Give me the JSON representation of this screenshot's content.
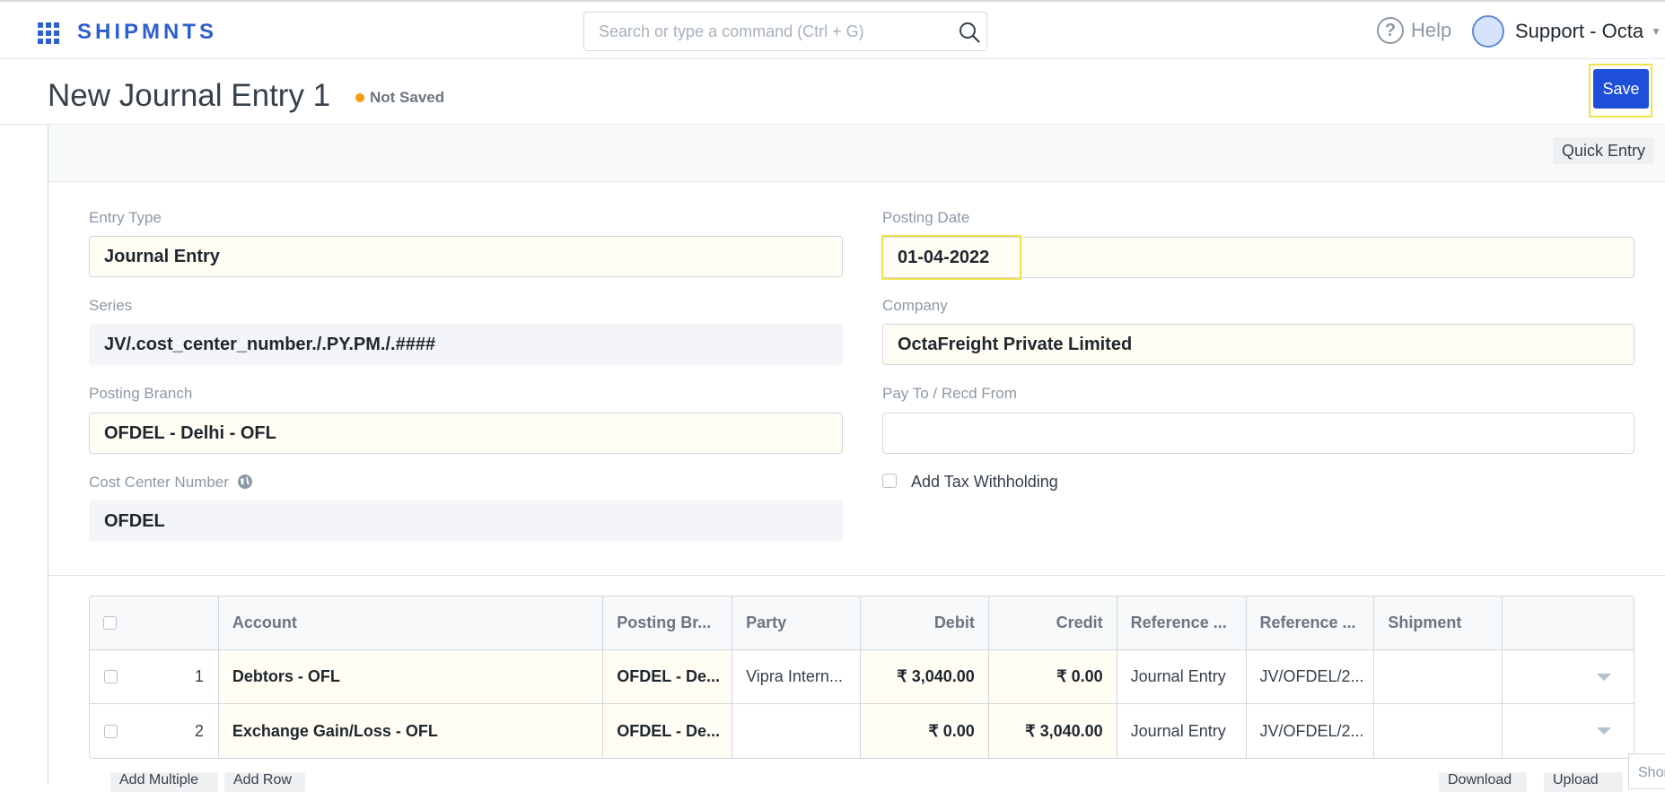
{
  "navbar": {
    "brand": "SHIPMNTS",
    "search_placeholder": "Search or type a command (Ctrl + G)",
    "help_label": "Help",
    "user_name": "Support - Octa"
  },
  "page": {
    "title": "New Journal Entry 1",
    "status": "Not Saved",
    "save_label": "Save",
    "quick_entry_label": "Quick Entry"
  },
  "form": {
    "entry_type": {
      "label": "Entry Type",
      "value": "Journal Entry"
    },
    "series": {
      "label": "Series",
      "value": "JV/.cost_center_number./.PY.PM./.####"
    },
    "posting_branch": {
      "label": "Posting Branch",
      "value": "OFDEL - Delhi - OFL"
    },
    "cost_center_number": {
      "label": "Cost Center Number",
      "value": "OFDEL"
    },
    "posting_date": {
      "label": "Posting Date",
      "value": "01-04-2022"
    },
    "company": {
      "label": "Company",
      "value": "OctaFreight Private Limited"
    },
    "pay_to": {
      "label": "Pay To / Recd From",
      "value": ""
    },
    "add_tax_withholding": {
      "label": "Add Tax Withholding",
      "checked": false
    }
  },
  "accounts_table": {
    "columns": [
      "Account",
      "Posting Br...",
      "Party",
      "Debit",
      "Credit",
      "Reference ...",
      "Reference ...",
      "Shipment"
    ],
    "rows": [
      {
        "idx": "1",
        "account": "Debtors - OFL",
        "posting_branch": "OFDEL - De...",
        "party": "Vipra Intern...",
        "debit": "₹ 3,040.00",
        "credit": "₹ 0.00",
        "reference_type": "Journal Entry",
        "reference_name": "JV/OFDEL/2...",
        "shipment": ""
      },
      {
        "idx": "2",
        "account": "Exchange Gain/Loss - OFL",
        "posting_branch": "OFDEL - De...",
        "party": "",
        "debit": "₹ 0.00",
        "credit": "₹ 3,040.00",
        "reference_type": "Journal Entry",
        "reference_name": "JV/OFDEL/2...",
        "shipment": ""
      }
    ],
    "add_multiple_label": "Add Multiple",
    "add_row_label": "Add Row",
    "download_label": "Download",
    "upload_label": "Upload"
  },
  "shortcut_tab_label": "Shortcuts",
  "colors": {
    "primary": "#1d4fd8",
    "brand": "#2d5fce",
    "status_dot": "#f39c12",
    "highlight": "#f0e34a"
  }
}
